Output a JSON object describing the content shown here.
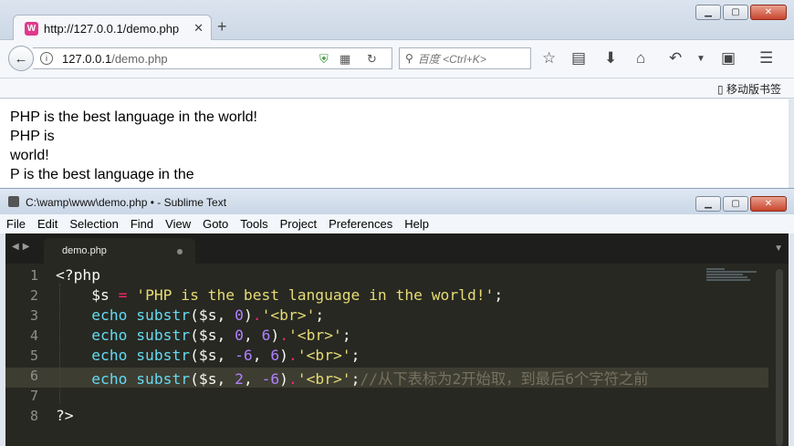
{
  "browser": {
    "tab_title": "http://127.0.0.1/demo.php",
    "url_host": "127.0.0.1",
    "url_path": "/demo.php",
    "search_placeholder": "百度 <Ctrl+K>",
    "mobile_bookmarks": "移动版书签",
    "page_lines": [
      "PHP is the best language in the world!",
      "PHP is",
      "world!",
      "P is the best language in the"
    ]
  },
  "editor": {
    "window_title": "C:\\wamp\\www\\demo.php • - Sublime Text",
    "menu": [
      "File",
      "Edit",
      "Selection",
      "Find",
      "View",
      "Goto",
      "Tools",
      "Project",
      "Preferences",
      "Help"
    ],
    "tab_name": "demo.php",
    "line_numbers": [
      "1",
      "2",
      "3",
      "4",
      "5",
      "6",
      "7",
      "8"
    ],
    "current_line": 6,
    "code": {
      "l1": "<?php",
      "l2_var": "$s",
      "l2_eq": "=",
      "l2_str": "'PHP is the best language in the world!'",
      "l2_end": ";",
      "echo": "echo",
      "substr": "substr",
      "s_arg": "$s",
      "comma": ",",
      "dot": ".",
      "br": "'<br>'",
      "semi": ";",
      "l3_a": "0",
      "l4_a": "0",
      "l4_b": "6",
      "l5_a": "-6",
      "l5_b": "6",
      "l6_a": "2",
      "l6_b": "-6",
      "l6_comment": "//从下表标为2开始取，到最后6个字符之前",
      "l8": "?>"
    }
  },
  "colors": {
    "editor_bg": "#272822",
    "keyword": "#66d9ef",
    "operator": "#f92672",
    "string": "#e6db74",
    "number": "#ae81ff",
    "comment": "#75715e"
  }
}
